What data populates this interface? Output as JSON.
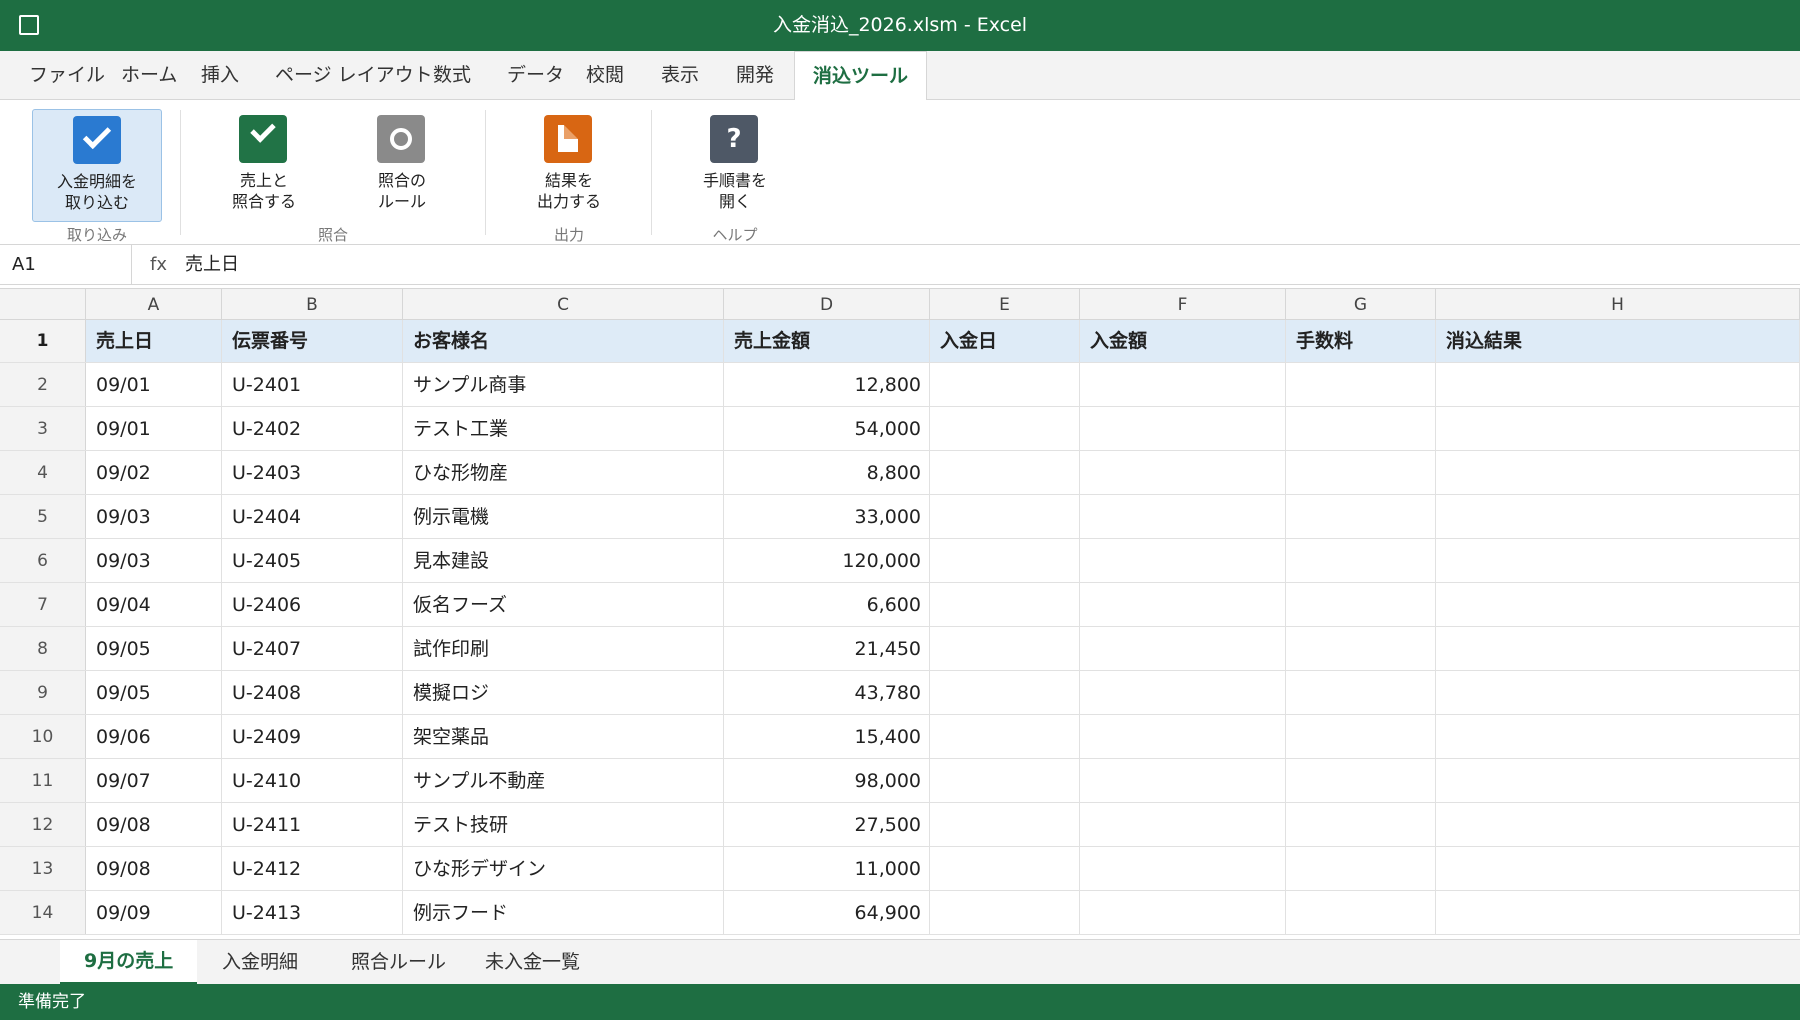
{
  "window": {
    "title": "入金消込_2026.xlsm - Excel"
  },
  "menu": {
    "tabs": [
      "ファイル",
      "ホーム",
      "挿入",
      "ページ レイアウト",
      "数式",
      "データ",
      "校閲",
      "表示",
      "開発",
      "消込ツール"
    ],
    "active": "消込ツール"
  },
  "ribbon": {
    "import_label_1": "入金明細を",
    "import_label_2": "取り込む",
    "match_label_1": "売上と",
    "match_label_2": "照合する",
    "rules_label_1": "照合の",
    "rules_label_2": "ルール",
    "output_label_1": "結果を",
    "output_label_2": "出力する",
    "help_label_1": "手順書を",
    "help_label_2": "開く",
    "help_icon_glyph": "?",
    "groups": {
      "import": "取り込み",
      "match": "照合",
      "output": "出力",
      "help": "ヘルプ"
    },
    "icons": {
      "import": "checkmark-down-icon",
      "match": "checkmark-icon",
      "rules": "circle-icon",
      "output": "document-icon",
      "help": "question-icon"
    }
  },
  "formula_bar": {
    "cell_ref": "A1",
    "fx": "fx",
    "formula": "売上日"
  },
  "sheet": {
    "column_letters": [
      "A",
      "B",
      "C",
      "D",
      "E",
      "F",
      "G",
      "H"
    ],
    "headers": [
      "売上日",
      "伝票番号",
      "お客様名",
      "売上金額",
      "入金日",
      "入金額",
      "手数料",
      "消込結果"
    ],
    "rows": [
      {
        "num": "2",
        "date": "09/01",
        "slip": "U-2401",
        "customer": "サンプル商事",
        "amount": "12,800"
      },
      {
        "num": "3",
        "date": "09/01",
        "slip": "U-2402",
        "customer": "テスト工業",
        "amount": "54,000"
      },
      {
        "num": "4",
        "date": "09/02",
        "slip": "U-2403",
        "customer": "ひな形物産",
        "amount": "8,800"
      },
      {
        "num": "5",
        "date": "09/03",
        "slip": "U-2404",
        "customer": "例示電機",
        "amount": "33,000"
      },
      {
        "num": "6",
        "date": "09/03",
        "slip": "U-2405",
        "customer": "見本建設",
        "amount": "120,000"
      },
      {
        "num": "7",
        "date": "09/04",
        "slip": "U-2406",
        "customer": "仮名フーズ",
        "amount": "6,600"
      },
      {
        "num": "8",
        "date": "09/05",
        "slip": "U-2407",
        "customer": "試作印刷",
        "amount": "21,450"
      },
      {
        "num": "9",
        "date": "09/05",
        "slip": "U-2408",
        "customer": "模擬ロジ",
        "amount": "43,780"
      },
      {
        "num": "10",
        "date": "09/06",
        "slip": "U-2409",
        "customer": "架空薬品",
        "amount": "15,400"
      },
      {
        "num": "11",
        "date": "09/07",
        "slip": "U-2410",
        "customer": "サンプル不動産",
        "amount": "98,000"
      },
      {
        "num": "12",
        "date": "09/08",
        "slip": "U-2411",
        "customer": "テスト技研",
        "amount": "27,500"
      },
      {
        "num": "13",
        "date": "09/08",
        "slip": "U-2412",
        "customer": "ひな形デザイン",
        "amount": "11,000"
      },
      {
        "num": "14",
        "date": "09/09",
        "slip": "U-2413",
        "customer": "例示フード",
        "amount": "64,900"
      }
    ]
  },
  "sheet_tabs": [
    "9月の売上",
    "入金明細",
    "照合ルール",
    "未入金一覧"
  ],
  "status": {
    "text": "準備完了"
  },
  "colors": {
    "brand": "#1e6e42",
    "header_fill": "#deebf7"
  }
}
